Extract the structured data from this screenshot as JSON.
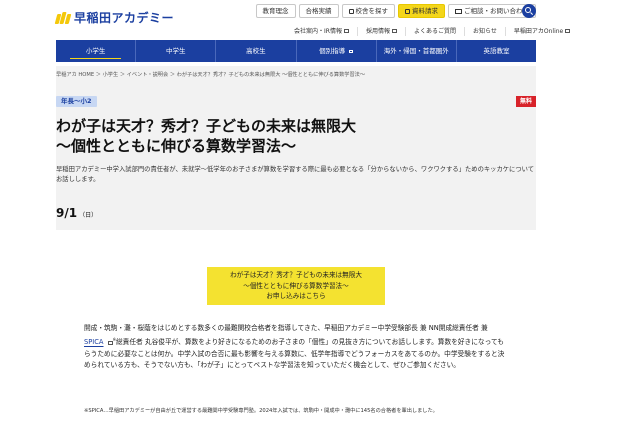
{
  "header": {
    "logo_text": "早稲田アカデミー",
    "top_links": [
      {
        "label": "教育理念"
      },
      {
        "label": "合格実績"
      },
      {
        "label": "校舎を探す"
      },
      {
        "label": "資料請求"
      },
      {
        "label": "ご相談・お問い合わせ"
      }
    ],
    "sub_links": [
      {
        "label": "会社案内・IR情報"
      },
      {
        "label": "採用情報"
      },
      {
        "label": "よくあるご質問"
      },
      {
        "label": "お知らせ"
      },
      {
        "label": "早稲田アカOnline"
      }
    ]
  },
  "nav": {
    "items": [
      {
        "label": "小学生"
      },
      {
        "label": "中学生"
      },
      {
        "label": "高校生"
      },
      {
        "label": "個別指導"
      },
      {
        "label": "海外・帰国・首都圏外"
      },
      {
        "label": "英語教室"
      }
    ]
  },
  "breadcrumb": "早稲アカ HOME ＞ 小学生 ＞ イベント・説明会 ＞ わが子は天才？秀才？子どもの未来は無限大 〜個性とともに伸びる算数学習法〜",
  "event": {
    "tag": "年長〜小2",
    "badge": "無料",
    "title_line1": "わが子は天才？秀才？子どもの未来は無限大",
    "title_line2": "〜個性とともに伸びる算数学習法〜",
    "description": "早稲田アカデミー中学入試部門の責任者が、未就学〜低学年のお子さまが算数を学習する際に最も必要となる「分からないから、ワクワクする」ためのキッカケについてお話しします。",
    "date": "9/1",
    "weekday": "（日）"
  },
  "cta": {
    "line1": "わが子は天才？秀才？子どもの未来は無限大",
    "line2": "〜個性とともに伸びる算数学習法〜",
    "line3": "お申し込みはこちら"
  },
  "body": {
    "part1": "開成・筑駒・灘・桜蔭をはじめとする数多くの最難関校合格者を指導してきた、早稲田アカデミー中学受験部長 兼 NN開成総責任者 兼 ",
    "spica": "SPICA",
    "spica_mark": "※",
    "part2": "総責任者 丸谷俊平が、算数をより好きになるためのお子さまの「個性」の見抜き方についてお話しします。算数を好きになってもらうために必要なことは何か。中学入試の合否に最も影響を与える算数に、低学年指導でどうフォーカスをあてるのか。中学受験をすると決められている方も、そうでない方も、「わが子」にとってベストな学習法を知っていただく機会として、ぜひご参加ください。",
    "note": "※SPICA…早稲田アカデミーが自由が丘で運営する最難関中学受験専門塾。2024年入試では、筑駒中・開成中・灘中に145名の合格者を輩出しました。"
  },
  "colors": {
    "brand_blue": "#1b3fa0",
    "accent_yellow": "#f4e230",
    "badge_red": "#d8232a"
  }
}
